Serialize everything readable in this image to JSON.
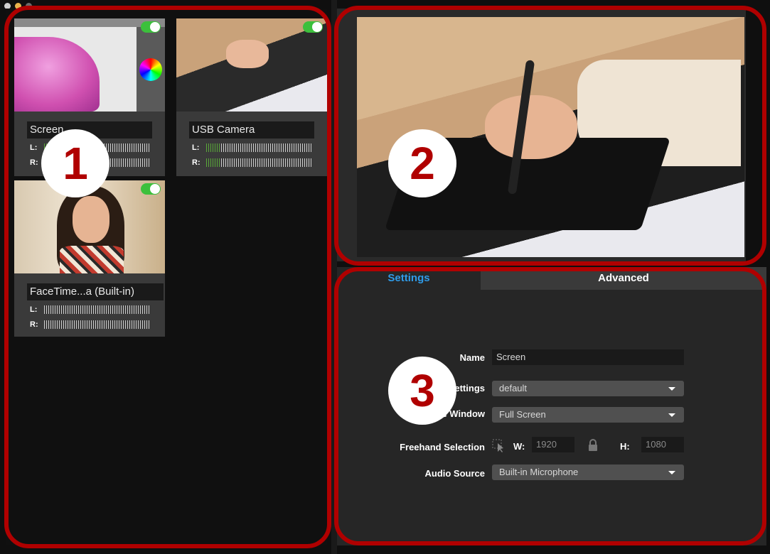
{
  "sources": [
    {
      "name": "Screen",
      "enabled": true,
      "meters": {
        "left_label": "L:",
        "right_label": "R:",
        "left_level": 0.05,
        "right_level": 0.0
      }
    },
    {
      "name": "USB Camera",
      "enabled": true,
      "meters": {
        "left_label": "L:",
        "right_label": "R:",
        "left_level": 0.14,
        "right_level": 0.14
      }
    },
    {
      "name": "FaceTime...a (Built-in)",
      "enabled": true,
      "meters": {
        "left_label": "L:",
        "right_label": "R:",
        "left_level": 0.0,
        "right_level": 0.0
      }
    }
  ],
  "tabs": {
    "settings": "Settings",
    "advanced": "Advanced"
  },
  "form": {
    "name_label": "Name",
    "name_value": "Screen",
    "settings_label": "ettings",
    "settings_value": "default",
    "window_label": "e Window",
    "window_value": "Full Screen",
    "freehand_label": "Freehand Selection",
    "w_label": "W:",
    "w_value": "1920",
    "h_label": "H:",
    "h_value": "1080",
    "audio_label": "Audio Source",
    "audio_value": "Built-in Microphone"
  },
  "annotations": {
    "one": "1",
    "two": "2",
    "three": "3"
  },
  "colors": {
    "ring": "#b00000",
    "accent_tab": "#2f9be8",
    "toggle_on": "#3cc03c"
  }
}
